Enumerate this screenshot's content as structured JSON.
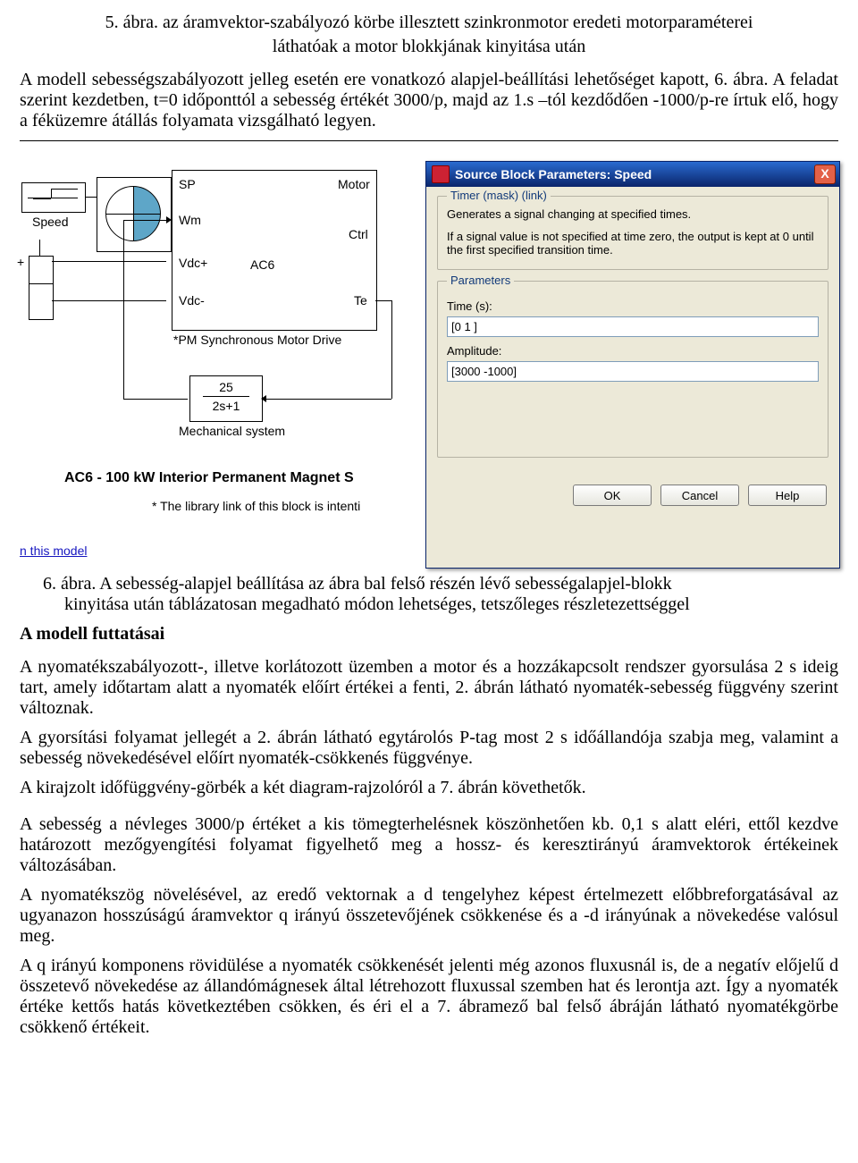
{
  "para1_center1": "5. ábra. az áramvektor-szabályozó körbe illesztett szinkronmotor eredeti motorparaméterei",
  "para1_center2": "láthatóak a motor blokkjának kinyitása után",
  "para2": "A modell sebességszabályozott jelleg esetén ere vonatkozó alapjel-beállítási lehetőséget kapott, 6. ábra. A feladat szerint kezdetben, t=0 időponttól a sebesség értékét 3000/p, majd az 1.s –tól kezdődően   -1000/p-re írtuk elő, hogy a féküzemre átállás folyamata vizsgálható legyen.",
  "sim": {
    "speed_label": "Speed",
    "sp": "SP",
    "wm": "Wm",
    "vdcp": "Vdc+",
    "vdcm": "Vdc-",
    "motor": "Motor",
    "ctrl": "Ctrl",
    "te": "Te",
    "ac6": "AC6",
    "pm_note": "*PM Synchronous Motor Drive",
    "tf_num": "25",
    "tf_den": "2s+1",
    "mech_label": "Mechanical system",
    "title_bold": "AC6 - 100 kW Interior Permanent Magnet S",
    "lib_note": "* The library link of this block is intenti",
    "link_line": "n this model"
  },
  "dialog": {
    "title": "Source Block Parameters: Speed",
    "close": "X",
    "legend1": "Timer (mask) (link)",
    "desc1": "Generates a signal changing at specified times.",
    "desc2": "If a signal value is not specified at time zero, the output is kept at 0 until the first specified transition time.",
    "legend2": "Parameters",
    "time_label": "Time (s):",
    "time_value": "[0 1 ]",
    "amp_label": "Amplitude:",
    "amp_value": "[3000 -1000]",
    "ok": "OK",
    "cancel": "Cancel",
    "help": "Help"
  },
  "caption6a": "6. ábra. A sebesség-alapjel beállítása az ábra bal felső részén lévő sebességalapjel-blokk",
  "caption6b": "kinyitása után táblázatosan megadható módon lehetséges, tetszőleges részletezettséggel",
  "section": "A modell futtatásai",
  "p3": "A nyomatékszabályozott-, illetve korlátozott üzemben a motor és a hozzákapcsolt rendszer gyorsulása 2 s ideig tart, amely időtartam alatt a nyomaték előírt értékei a fenti, 2. ábrán látható nyomaték-sebesség függvény szerint változnak.",
  "p4": "A gyorsítási folyamat jellegét a 2. ábrán látható egytárolós P-tag most 2 s időállandója szabja meg, valamint a sebesség növekedésével előírt nyomaték-csökkenés függvénye.",
  "p5": "A kirajzolt időfüggvény-görbék a két diagram-rajzolóról a 7. ábrán követhetők.",
  "p6": "A sebesség a névleges 3000/p értéket a kis tömegterhelésnek köszönhetően kb. 0,1 s alatt eléri, ettől kezdve határozott mezőgyengítési folyamat figyelhető meg a hossz- és keresztirányú áramvektorok értékeinek változásában.",
  "p7": "A nyomatékszög növelésével, az eredő vektornak a d tengelyhez képest értelmezett előbbreforgatásával az ugyanazon hosszúságú áramvektor q irányú összetevőjének csökkenése és a -d irányúnak a növekedése valósul meg.",
  "p8": "A q irányú komponens rövidülése a nyomaték csökkenését jelenti még azonos fluxusnál is, de a negatív előjelű d összetevő növekedése az állandómágnesek által létrehozott fluxussal szemben hat és lerontja azt. Így a nyomaték értéke kettős hatás következtében csökken, és éri el a 7. ábramező bal felső ábráján látható nyomatékgörbe csökkenő értékeit."
}
